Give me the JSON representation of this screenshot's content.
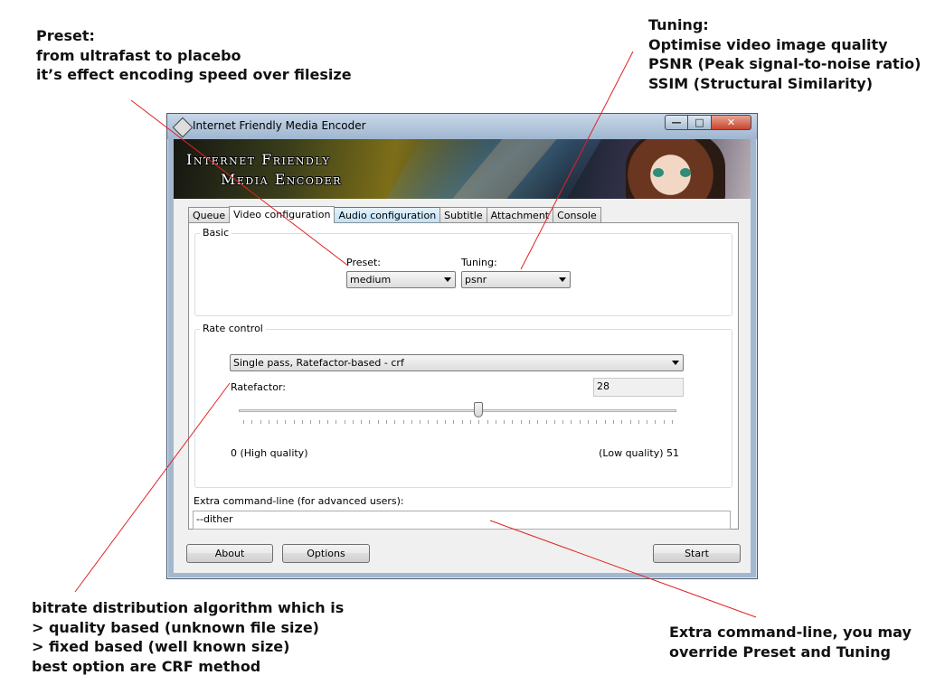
{
  "annotations": {
    "preset": [
      "Preset:",
      "from ultrafast to placebo",
      "it’s effect encoding speed over filesize"
    ],
    "tuning": [
      "Tuning:",
      "Optimise video image quality",
      "PSNR (Peak signal-to-noise ratio)",
      "SSIM (Structural Similarity)"
    ],
    "bitrate": [
      "bitrate distribution algorithm which is",
      "> quality based (unknown file size)",
      "> fixed based (well known size)",
      "best option are CRF method"
    ],
    "extra": [
      "Extra command-line, you may",
      "override Preset and Tuning"
    ]
  },
  "window": {
    "title": "Internet Friendly Media Encoder",
    "buttons": {
      "minimize": "—",
      "maximize": "□",
      "close": "✕"
    }
  },
  "banner": {
    "line1": "Internet Friendly",
    "line2": "Media Encoder"
  },
  "tabs": [
    {
      "label": "Queue"
    },
    {
      "label": "Video configuration"
    },
    {
      "label": "Audio configuration"
    },
    {
      "label": "Subtitle"
    },
    {
      "label": "Attachment"
    },
    {
      "label": "Console"
    }
  ],
  "basic": {
    "group_label": "Basic",
    "preset_label": "Preset:",
    "preset_value": "medium",
    "tuning_label": "Tuning:",
    "tuning_value": "psnr"
  },
  "rate_control": {
    "group_label": "Rate control",
    "mode_value": "Single pass, Ratefactor-based - crf",
    "ratefactor_label": "Ratefactor:",
    "ratefactor_value": "28",
    "slider_min": 0,
    "slider_max": 51,
    "slider_value": 28,
    "min_label": "0 (High quality)",
    "max_label": "(Low quality) 51"
  },
  "extra": {
    "label": "Extra command-line (for advanced users):",
    "value": "--dither"
  },
  "footer": {
    "about": "About",
    "options": "Options",
    "start": "Start"
  },
  "icons": {
    "app": "app-diamond-icon",
    "dropdown": "chevron-down-icon"
  }
}
